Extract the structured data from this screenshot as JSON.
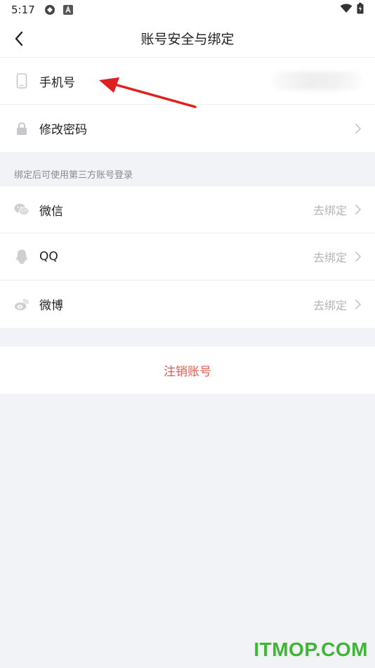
{
  "status_bar": {
    "time": "5:17"
  },
  "header": {
    "title": "账号安全与绑定"
  },
  "account": {
    "phone": {
      "label": "手机号",
      "icon": "phone-icon"
    },
    "password": {
      "label": "修改密码",
      "icon": "lock-icon"
    }
  },
  "third_party": {
    "caption": "绑定后可使用第三方账号登录",
    "items": [
      {
        "label": "微信",
        "status": "去绑定",
        "icon": "wechat-icon"
      },
      {
        "label": "QQ",
        "status": "去绑定",
        "icon": "qq-icon"
      },
      {
        "label": "微博",
        "status": "去绑定",
        "icon": "weibo-icon"
      }
    ]
  },
  "danger": {
    "label": "注销账号"
  },
  "watermark": "ITMOP.COM",
  "colors": {
    "danger": "#e8584c",
    "icon_gray": "#c8c8cc",
    "annotation_arrow": "#e02020",
    "watermark": "#3fb535"
  }
}
